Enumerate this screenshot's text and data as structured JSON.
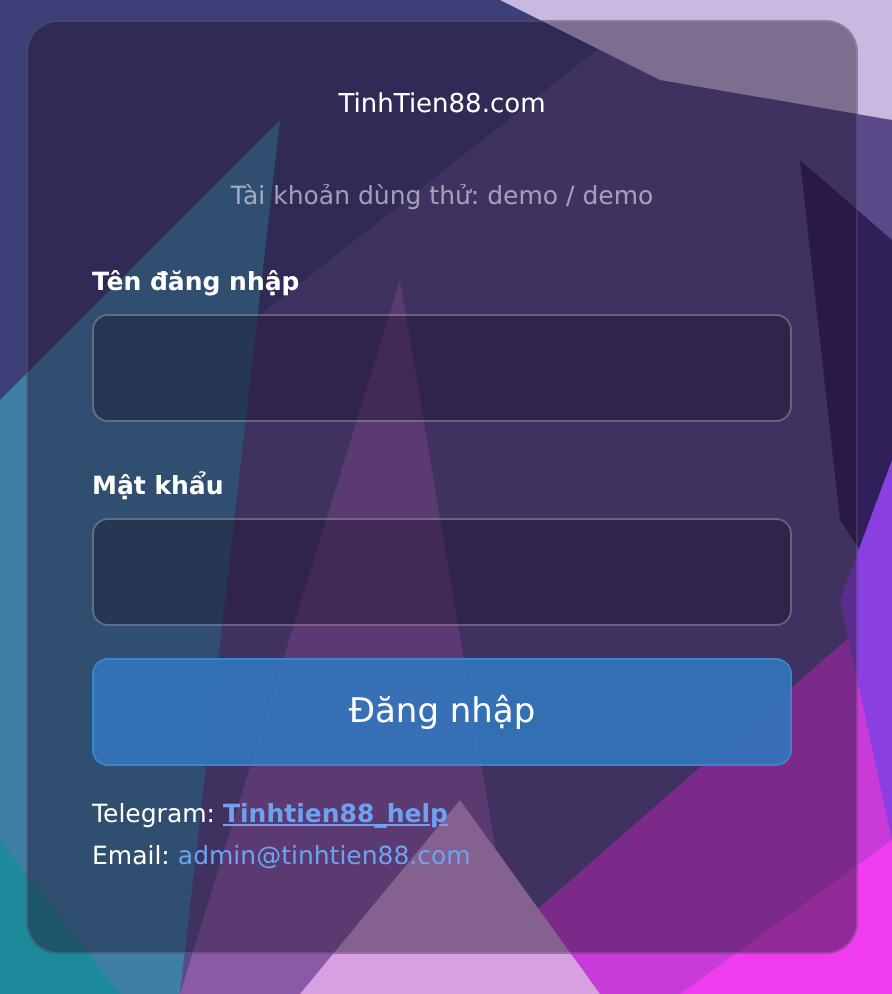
{
  "site_title": "TinhTien88.com",
  "hint": "Tài khoản dùng thử: demo / demo",
  "fields": [
    {
      "label": "Tên đăng nhập"
    },
    {
      "label": "Mật khẩu"
    }
  ],
  "submit_button": "Đăng nhập",
  "contacts": [
    {
      "label": "Telegram:",
      "link": "Tinhtien88_help",
      "underlined": true
    },
    {
      "label": "Email:",
      "link": "admin@tinhtien88.com",
      "underlined": false
    }
  ]
}
